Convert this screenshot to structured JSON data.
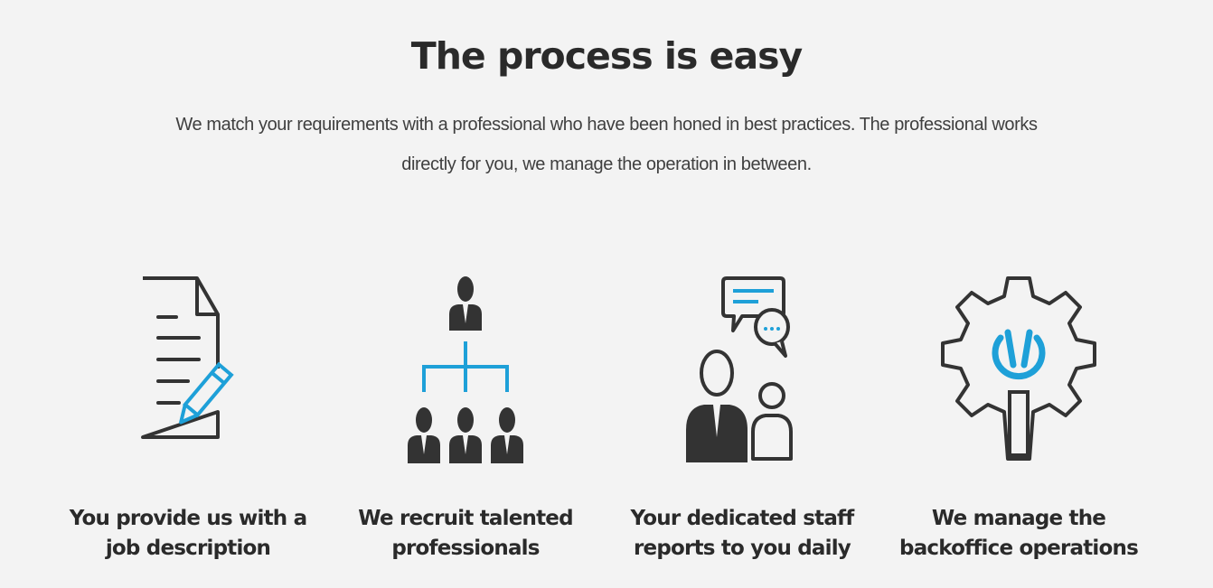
{
  "section": {
    "title": "The process is easy",
    "subtitle": "We match your requirements with a professional who have been honed in best practices. The professional works directly for you, we manage the operation in between."
  },
  "steps": [
    {
      "icon": "document-pencil-icon",
      "label": "You provide us with a job description"
    },
    {
      "icon": "org-chart-icon",
      "label": "We recruit talented professionals"
    },
    {
      "icon": "people-chat-icon",
      "label": "Your dedicated staff reports to you daily"
    },
    {
      "icon": "gear-wrench-icon",
      "label": "We manage the backoffice operations"
    }
  ],
  "colors": {
    "background": "#f3f3f3",
    "text": "#2b2b2b",
    "icon_dark": "#333333",
    "icon_accent": "#1ea0d8"
  }
}
